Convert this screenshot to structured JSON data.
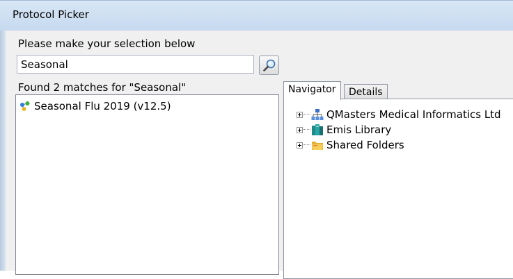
{
  "window": {
    "title": "Protocol Picker"
  },
  "search": {
    "prompt": "Please make your selection below",
    "value": "Seasonal",
    "button_icon": "search-icon"
  },
  "results": {
    "summary": "Found 2 matches for \"Seasonal\"",
    "items": [
      {
        "label": "Seasonal Flu 2019 (v12.5)",
        "icon": "protocol-molecule-icon"
      }
    ]
  },
  "tabs": [
    {
      "label": "Navigator",
      "active": true
    },
    {
      "label": "Details",
      "active": false
    }
  ],
  "tree": {
    "nodes": [
      {
        "label": "QMasters Medical Informatics Ltd",
        "icon": "org-chart-icon"
      },
      {
        "label": "Emis Library",
        "icon": "library-books-icon"
      },
      {
        "label": "Shared Folders",
        "icon": "folder-icon"
      }
    ]
  },
  "colors": {
    "titlebar": "#c6d9ef",
    "panel_bg": "#f0f0f0",
    "border": "#828790"
  }
}
